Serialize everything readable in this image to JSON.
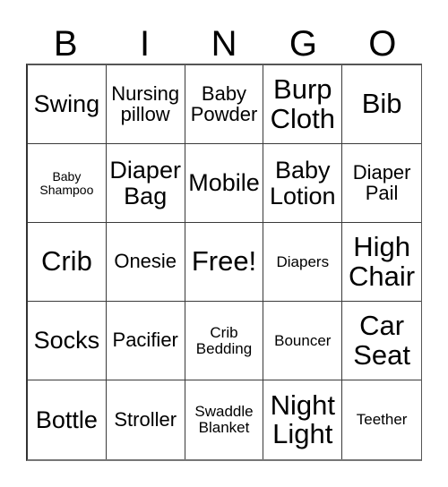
{
  "card": {
    "title_letters": [
      "B",
      "I",
      "N",
      "G",
      "O"
    ],
    "grid": {
      "columns": 5,
      "rows": 5,
      "border_color": "#3a3a3a",
      "background_color": "#ffffff",
      "text_color": "#000000"
    },
    "cells": [
      {
        "text": "Swing",
        "size": "lg"
      },
      {
        "text": "Nursing pillow",
        "size": "md"
      },
      {
        "text": "Baby Powder",
        "size": "md"
      },
      {
        "text": "Burp Cloth",
        "size": "xl"
      },
      {
        "text": "Bib",
        "size": "xl"
      },
      {
        "text": "Baby Shampoo",
        "size": "xs"
      },
      {
        "text": "Diaper Bag",
        "size": "lg"
      },
      {
        "text": "Mobile",
        "size": "lg"
      },
      {
        "text": "Baby Lotion",
        "size": "lg"
      },
      {
        "text": "Diaper Pail",
        "size": "md"
      },
      {
        "text": "Crib",
        "size": "xl"
      },
      {
        "text": "Onesie",
        "size": "md"
      },
      {
        "text": "Free!",
        "size": "xl"
      },
      {
        "text": "Diapers",
        "size": "sm"
      },
      {
        "text": "High Chair",
        "size": "xl"
      },
      {
        "text": "Socks",
        "size": "lg"
      },
      {
        "text": "Pacifier",
        "size": "md"
      },
      {
        "text": "Crib Bedding",
        "size": "sm"
      },
      {
        "text": "Bouncer",
        "size": "sm"
      },
      {
        "text": "Car Seat",
        "size": "xl"
      },
      {
        "text": "Bottle",
        "size": "lg"
      },
      {
        "text": "Stroller",
        "size": "md"
      },
      {
        "text": "Swaddle Blanket",
        "size": "sm"
      },
      {
        "text": "Night Light",
        "size": "xl"
      },
      {
        "text": "Teether",
        "size": "sm"
      }
    ]
  }
}
